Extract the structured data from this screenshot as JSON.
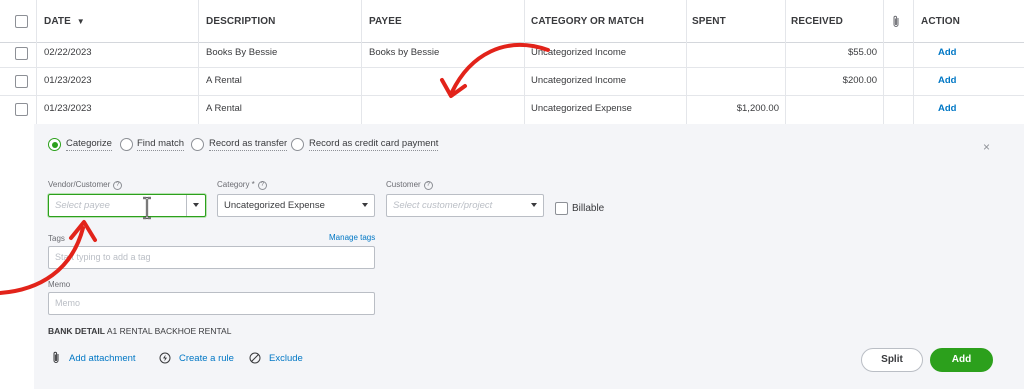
{
  "table": {
    "headers": {
      "date": "DATE",
      "description": "DESCRIPTION",
      "payee": "PAYEE",
      "category": "CATEGORY OR MATCH",
      "spent": "SPENT",
      "received": "RECEIVED",
      "action": "ACTION"
    },
    "rows": [
      {
        "date": "02/22/2023",
        "description": "Books By Bessie",
        "payee": "Books by Bessie",
        "category": "Uncategorized Income",
        "spent": "",
        "received": "$55.00",
        "action": "Add"
      },
      {
        "date": "01/23/2023",
        "description": "A Rental",
        "payee": "",
        "category": "Uncategorized Income",
        "spent": "",
        "received": "$200.00",
        "action": "Add"
      },
      {
        "date": "01/23/2023",
        "description": "A Rental",
        "payee": "",
        "category": "Uncategorized Expense",
        "spent": "$1,200.00",
        "received": "",
        "action": "Add"
      }
    ]
  },
  "panel": {
    "options": {
      "categorize": "Categorize",
      "find_match": "Find match",
      "record_transfer": "Record as transfer",
      "record_cc_payment": "Record as credit card payment"
    },
    "selected_option": "categorize",
    "vendor": {
      "label": "Vendor/Customer",
      "placeholder": "Select payee",
      "value": ""
    },
    "category": {
      "label": "Category *",
      "value": "Uncategorized Expense"
    },
    "customer": {
      "label": "Customer",
      "placeholder": "Select customer/project",
      "value": ""
    },
    "billable": {
      "label": "Billable",
      "checked": false
    },
    "tags": {
      "label": "Tags",
      "manage_link": "Manage tags",
      "placeholder": "Start typing to add a tag"
    },
    "memo": {
      "label": "Memo",
      "placeholder": "Memo"
    },
    "bank_detail": {
      "label": "BANK DETAIL",
      "value": "A1 RENTAL BACKHOE RENTAL"
    },
    "footer_links": {
      "attachment": "Add attachment",
      "rule": "Create a rule",
      "exclude": "Exclude"
    },
    "buttons": {
      "split": "Split",
      "add": "Add"
    }
  },
  "colors": {
    "accent_green": "#2ca01c",
    "link_blue": "#0077c5",
    "annotation_red": "#e2231a"
  },
  "icons": {
    "sort": "sort-desc-icon",
    "attachment": "paperclip-icon",
    "close": "close-icon",
    "rule": "lightning-circle-icon",
    "exclude": "ban-circle-icon"
  }
}
